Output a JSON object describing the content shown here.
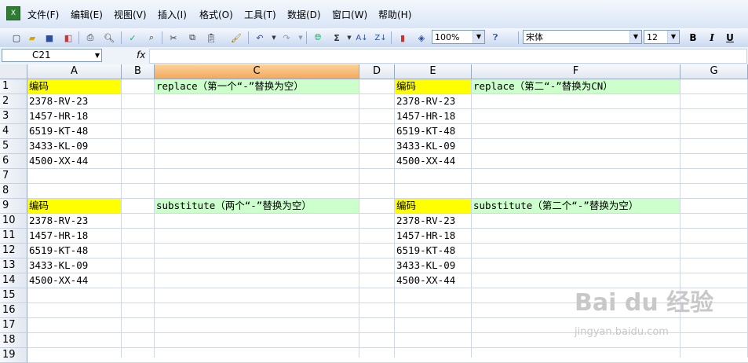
{
  "menubar": {
    "items": [
      "文件(F)",
      "编辑(E)",
      "视图(V)",
      "插入(I)",
      "格式(O)",
      "工具(T)",
      "数据(D)",
      "窗口(W)",
      "帮助(H)"
    ]
  },
  "toolbar": {
    "zoom": "100%",
    "font_name": "宋体",
    "font_size": "12",
    "bold": "B",
    "italic": "I",
    "underline": "U"
  },
  "formula_bar": {
    "name_box": "C21",
    "fx": "fx",
    "formula": ""
  },
  "columns": [
    "A",
    "B",
    "C",
    "D",
    "E",
    "F",
    "G"
  ],
  "selected_column": "C",
  "rows": [
    "1",
    "2",
    "3",
    "4",
    "5",
    "6",
    "7",
    "8",
    "9",
    "10",
    "11",
    "12",
    "13",
    "14",
    "15",
    "16",
    "17",
    "18",
    "19"
  ],
  "cells": {
    "A1": "编码",
    "C1": "replace（第一个“-”替换为空）",
    "E1": "编码",
    "F1": "replace（第二“-”替换为CN）",
    "A2": "2378-RV-23",
    "A3": "1457-HR-18",
    "A4": "6519-KT-48",
    "A5": "3433-KL-09",
    "A6": "4500-XX-44",
    "E2": "2378-RV-23",
    "E3": "1457-HR-18",
    "E4": "6519-KT-48",
    "E5": "3433-KL-09",
    "E6": "4500-XX-44",
    "A9": "编码",
    "C9": "substitute（两个“-”替换为空）",
    "E9": "编码",
    "F9": "substitute（第二个“-”替换为空）",
    "A10": "2378-RV-23",
    "A11": "1457-HR-18",
    "A12": "6519-KT-48",
    "A13": "3433-KL-09",
    "A14": "4500-XX-44",
    "E10": "2378-RV-23",
    "E11": "1457-HR-18",
    "E12": "6519-KT-48",
    "E13": "3433-KL-09",
    "E14": "4500-XX-44"
  },
  "colors": {
    "header_yellow": "#ffff00",
    "header_green": "#ccffcc",
    "selected_column": "#f3a85c"
  },
  "watermark": {
    "logo": "Bai du 经验",
    "url": "jingyan.baidu.com"
  }
}
